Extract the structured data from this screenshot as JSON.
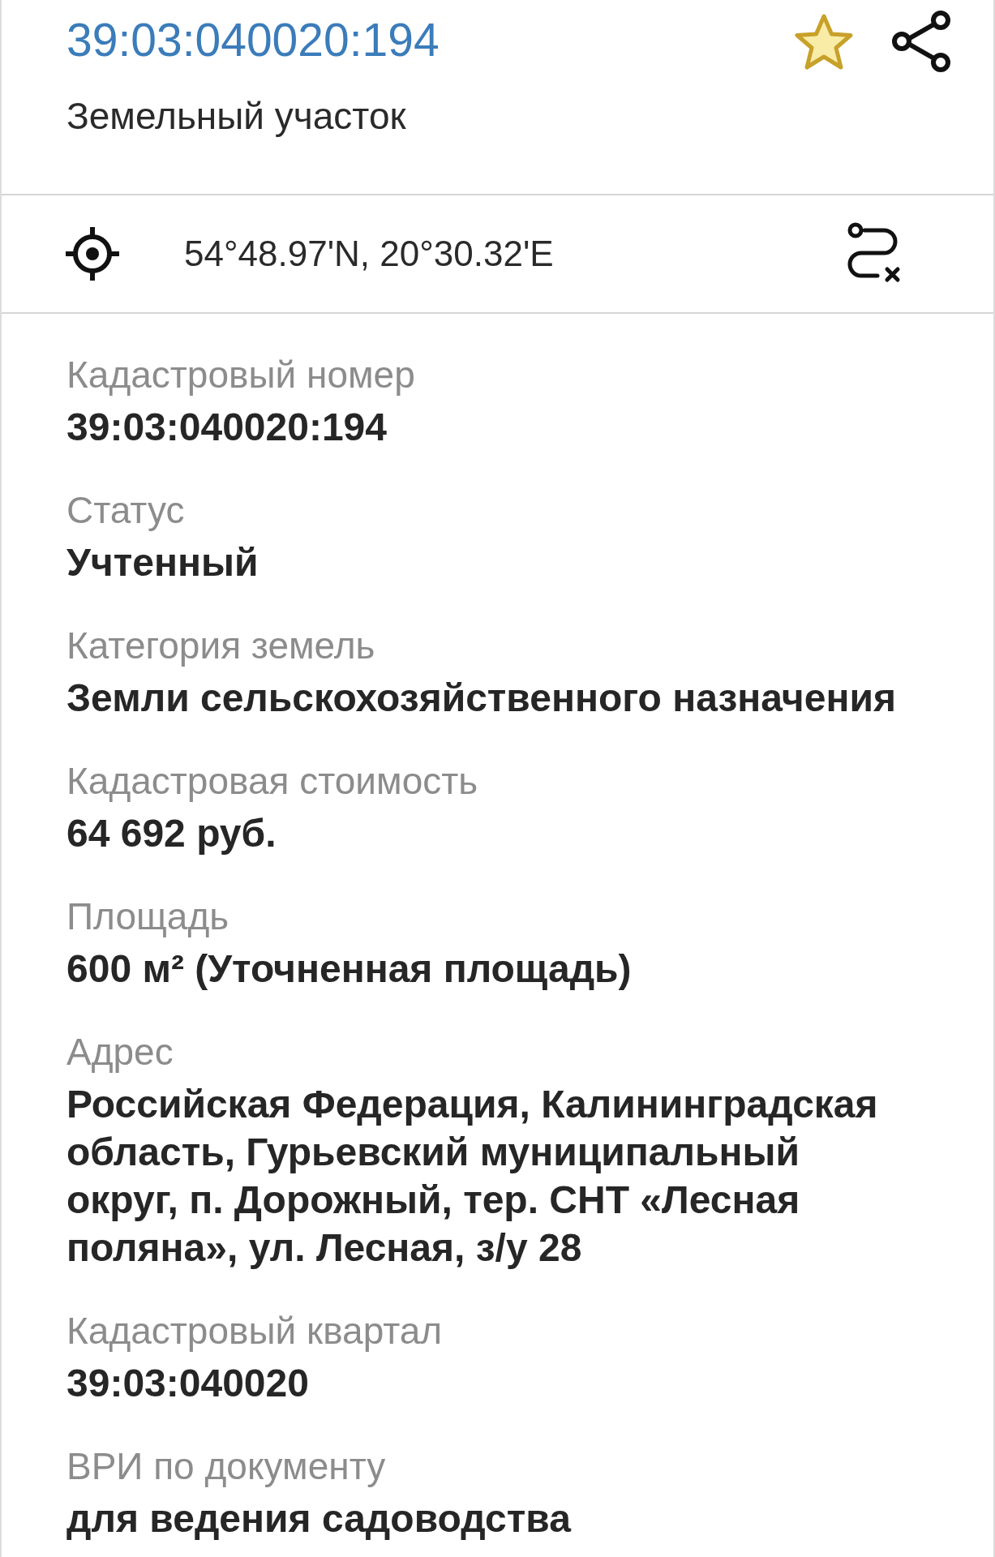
{
  "header": {
    "title": "39:03:040020:194",
    "subtitle": "Земельный участок"
  },
  "location": {
    "coordinates": "54°48.97'N, 20°30.32'E"
  },
  "fields": [
    {
      "label": "Кадастровый номер",
      "value": "39:03:040020:194"
    },
    {
      "label": "Статус",
      "value": "Учтенный"
    },
    {
      "label": "Категория земель",
      "value": "Земли сельскохозяйственного назначения"
    },
    {
      "label": "Кадастровая стоимость",
      "value": "64 692 руб."
    },
    {
      "label": "Площадь",
      "value": "600 м² (Уточненная площадь)"
    },
    {
      "label": "Адрес",
      "value": "Российская Федерация, Калининградская область, Гурьевский муниципальный округ, п. Дорожный, тер. СНТ «Лесная поляна», ул. Лесная, з/у 28"
    },
    {
      "label": "Кадастровый квартал",
      "value": "39:03:040020"
    },
    {
      "label": "ВРИ по документу",
      "value": "для ведения садоводства"
    }
  ]
}
